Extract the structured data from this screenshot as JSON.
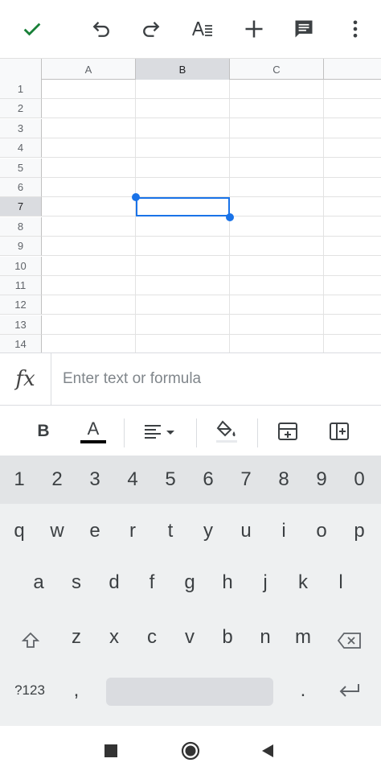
{
  "toolbar": {
    "icons": [
      "check-icon",
      "undo-icon",
      "redo-icon",
      "text-format-icon",
      "add-icon",
      "comment-icon",
      "more-vert-icon"
    ],
    "check_color": "#188038"
  },
  "grid": {
    "columns": [
      "A",
      "B",
      "C"
    ],
    "rows": [
      "1",
      "2",
      "3",
      "4",
      "5",
      "6",
      "7",
      "8",
      "9",
      "10",
      "11",
      "12",
      "13",
      "14"
    ],
    "selected_column": "B",
    "selected_row": "7",
    "selection_color": "#1a73e8"
  },
  "formula_bar": {
    "fx_label": "fx",
    "placeholder": "Enter text or formula",
    "value": ""
  },
  "format_toolbar": {
    "bold_label": "B",
    "text_color_label": "A",
    "icons": [
      "bold-icon",
      "text-color-icon",
      "align-icon",
      "fill-color-icon",
      "insert-row-icon",
      "insert-column-icon"
    ]
  },
  "keyboard": {
    "numbers": [
      "1",
      "2",
      "3",
      "4",
      "5",
      "6",
      "7",
      "8",
      "9",
      "0"
    ],
    "row1": [
      "q",
      "w",
      "e",
      "r",
      "t",
      "y",
      "u",
      "i",
      "o",
      "p"
    ],
    "row2": [
      "a",
      "s",
      "d",
      "f",
      "g",
      "h",
      "j",
      "k",
      "l"
    ],
    "row3": [
      "z",
      "x",
      "c",
      "v",
      "b",
      "n",
      "m"
    ],
    "symbols_label": "?123",
    "comma": ",",
    "period": "."
  },
  "navbar": {
    "icons": [
      "recents-icon",
      "home-icon",
      "back-icon"
    ]
  }
}
